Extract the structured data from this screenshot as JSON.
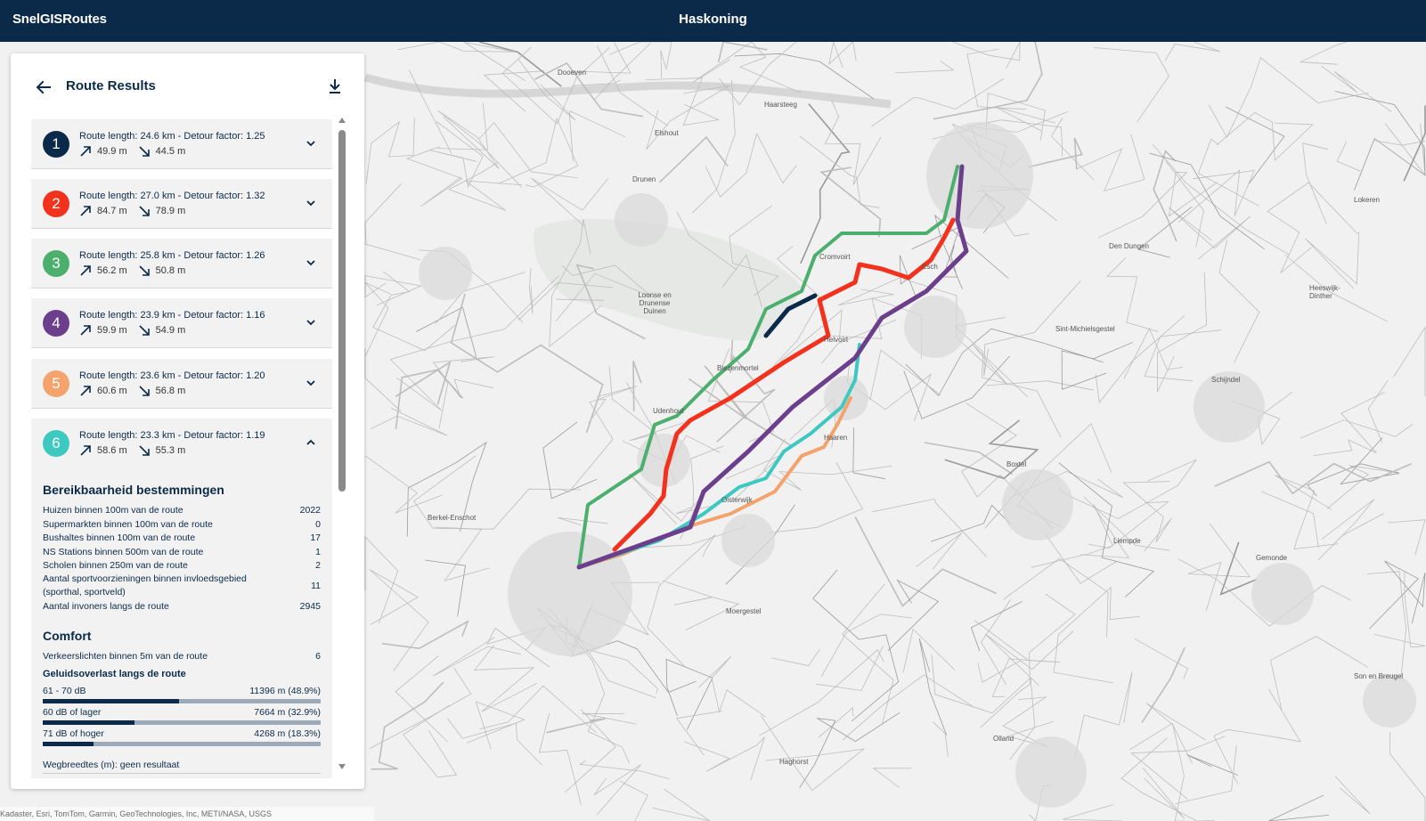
{
  "header": {
    "app_name": "SnelGISRoutes",
    "brand": "Haskoning"
  },
  "panel": {
    "title": "Route Results",
    "back_icon": "arrow-left-icon",
    "download_icon": "download-icon"
  },
  "routes": [
    {
      "number": "1",
      "color": "#0b2a49",
      "summary": "Route length: 24.6 km - Detour factor: 1.25",
      "ascent": "49.9 m",
      "descent": "44.5 m",
      "expanded": false
    },
    {
      "number": "2",
      "color": "#f2321d",
      "summary": "Route length: 27.0 km - Detour factor: 1.32",
      "ascent": "84.7 m",
      "descent": "78.9 m",
      "expanded": false
    },
    {
      "number": "3",
      "color": "#4caf6e",
      "summary": "Route length: 25.8 km - Detour factor: 1.26",
      "ascent": "56.2 m",
      "descent": "50.8 m",
      "expanded": false
    },
    {
      "number": "4",
      "color": "#6b3f8c",
      "summary": "Route length: 23.9 km - Detour factor: 1.16",
      "ascent": "59.9 m",
      "descent": "54.9 m",
      "expanded": false
    },
    {
      "number": "5",
      "color": "#f5a36c",
      "summary": "Route length: 23.6 km - Detour factor: 1.20",
      "ascent": "60.6 m",
      "descent": "56.8 m",
      "expanded": false
    },
    {
      "number": "6",
      "color": "#3ec9c0",
      "summary": "Route length: 23.3 km - Detour factor: 1.19",
      "ascent": "58.6 m",
      "descent": "55.3 m",
      "expanded": true
    }
  ],
  "details": {
    "reach_title": "Bereikbaarheid bestemmingen",
    "reach_rows": [
      {
        "label": "Huizen binnen 100m van de route",
        "value": "2022"
      },
      {
        "label": "Supermarkten binnen 100m van de route",
        "value": "0"
      },
      {
        "label": "Bushaltes binnen 100m van de route",
        "value": "17"
      },
      {
        "label": "NS Stations binnen 500m van de route",
        "value": "1"
      },
      {
        "label": "Scholen binnen 250m van de route",
        "value": "2"
      },
      {
        "label": "Aantal sportvoorzieningen binnen invloedsgebied (sporthal, sportveld)",
        "value": "11"
      },
      {
        "label": "Aantal invoners langs de route",
        "value": "2945"
      }
    ],
    "comfort_title": "Comfort",
    "traffic_lights": {
      "label": "Verkeerslichten binnen 5m van de route",
      "value": "6"
    },
    "noise_title": "Geluidsoverlast langs de route",
    "noise_rows": [
      {
        "label": "61 - 70 dB",
        "value": "11396 m (48.9%)",
        "fraction": 0.489
      },
      {
        "label": "60 dB of lager",
        "value": "7664 m (32.9%)",
        "fraction": 0.329
      },
      {
        "label": "71 dB of hoger",
        "value": "4268 m (18.3%)",
        "fraction": 0.183
      }
    ],
    "road_width": "Wegbreedtes (m): geen resultaat"
  },
  "map": {
    "attribution": "Kadaster, Esri, TomTom, Garmin, GeoTechnologies, Inc, METI/NASA, USGS",
    "labels": [
      "Dooeven",
      "Haarsteeg",
      "Elshout",
      "Drunen",
      "Loonse en Drunense Duinen",
      "Cromvoirt",
      "Biezenmortel",
      "Udenhout",
      "Helvoirt",
      "Esch",
      "Haaren",
      "Berkel-Enschot",
      "Moergestel",
      "Oisterwijk",
      "Boxtel",
      "Liempde",
      "Gemonde",
      "Schijndel",
      "Heeswijk-Dinther",
      "Olland",
      "Sint-Michielsgestel",
      "Den Dungen",
      "Lokeren",
      "Haghorst",
      "Son en Breugel"
    ]
  }
}
